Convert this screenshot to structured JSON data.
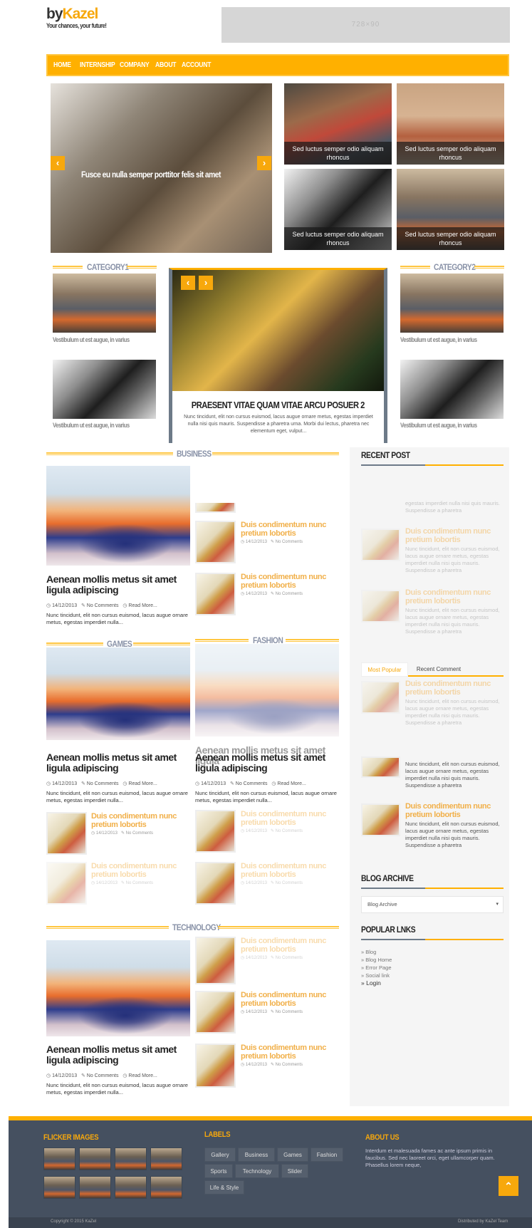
{
  "brand": {
    "prefix": "by",
    "name": "Kazel",
    "tagline": "Your chances, your future!"
  },
  "ad": {
    "label": "728×90"
  },
  "nav": {
    "items": [
      "HOME",
      "INTERNSHIP",
      "COMPANY",
      "ABOUT",
      "ACCOUNT"
    ]
  },
  "slider": {
    "title": "Fusce eu nulla semper porttitor felis sit amet",
    "prev": "‹",
    "next": "›"
  },
  "grid": {
    "captions": [
      "Sed luctus semper odio aliquam rhoncus",
      "Sed luctus semper odio aliquam rhoncus",
      "Sed luctus semper odio aliquam rhoncus",
      "Sed luctus semper odio aliquam rhoncus"
    ]
  },
  "category1": {
    "label": "CATEGORY1",
    "captions": [
      "Vestibulum ut est augue, in varius",
      "Vestibulum ut est augue, in varius"
    ]
  },
  "category2": {
    "label": "CATEGORY2",
    "captions": [
      "Vestibulum ut est augue, in varius",
      "Vestibulum ut est augue, in varius"
    ]
  },
  "featured": {
    "title": "PRAESENT VITAE QUAM VITAE ARCU POSUER 2",
    "text": "Nunc tincidunt, elit non cursus euismod, lacus augue ornare metus, egestas imperdiet nulla nisi quis mauris. Suspendisse a pharetra urna. Morbi dui lectus, pharetra nec elementum eget, vulput...",
    "prev": "‹",
    "next": "›"
  },
  "post": {
    "title": "Aenean mollis metus sit amet ligula adipiscing",
    "date": "14/12/2013",
    "comments": "No Comments",
    "readmore": "Read More...",
    "excerpt": "Nunc tincidunt, elit non cursus euismod, lacus augue ornare metus, egestas imperdiet nulla..."
  },
  "mini": {
    "title": "Duis condimentum nunc pretium lobortis",
    "date": "14/12/2013",
    "comments": "No Comments"
  },
  "sections": {
    "business": "BUSINESS",
    "games": "GAMES",
    "fashion": "FASHION",
    "technology": "TECHNOLOGY"
  },
  "fashion_ghost": "Aenean mollis metus sit amet ligula",
  "sidebar": {
    "recent": "RECENT POST",
    "partial": "egestas imperdiet nulla nisi quis mauris. Suspendisse a pharetra",
    "item_title": "Duis condimentum nunc pretium lobortis",
    "item_text": "Nunc tincidunt, elit non cursus euismod, lacus augue ornare metus, egestas imperdiet nulla nisi quis mauris. Suspendisse a pharetra",
    "tab_popular": "Most Popular",
    "tab_recent": "Recent Comment",
    "archive": "BLOG ARCHIVE",
    "archive_select": "Blog Archive",
    "links_head": "POPULAR LNKS",
    "links": [
      "» Blog",
      "» Blog Home",
      "» Error Page",
      "» Social link",
      "» Login"
    ]
  },
  "footer": {
    "flicker": "FLICKER IMAGES",
    "labels_head": "LABELS",
    "labels": [
      "Gallery",
      "Business",
      "Games",
      "Fashion",
      "Sports",
      "Technology",
      "Slider",
      "Life & Style"
    ],
    "about_head": "ABOUT US",
    "about_text": "Interdum et malesuada fames ac ante ipsum primis in faucibus. Sed nec laoreet orci, eget ullamcorper quam. Phasellus lorem neque,",
    "copyright": "Copyright © 2015 KaZel",
    "credit": "Distributed by KaZel Team",
    "totop": "⌃"
  },
  "colors": {
    "accent": "#ffb000",
    "slate": "#455060",
    "dark": "#3a4350"
  }
}
